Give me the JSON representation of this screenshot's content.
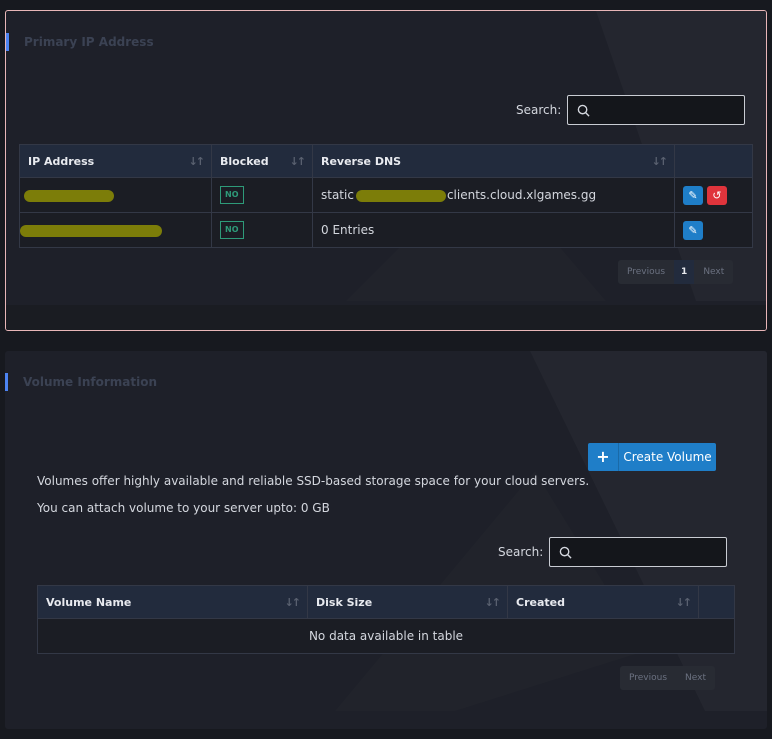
{
  "primary_ip": {
    "title": "Primary IP Address",
    "search_label": "Search:",
    "search_value": "",
    "columns": [
      "IP Address",
      "Blocked",
      "Reverse DNS",
      ""
    ],
    "rows": [
      {
        "ip": "",
        "blocked": "NO",
        "dns_prefix": "static",
        "dns_suffix": "clients.cloud.xlgames.gg"
      },
      {
        "ip": "",
        "blocked": "NO",
        "dns_text": "0 Entries"
      }
    ],
    "pagination": {
      "previous": "Previous",
      "current": "1",
      "next": "Next"
    }
  },
  "volume": {
    "title": "Volume Information",
    "create_button": "Create Volume",
    "description": "Volumes offer highly available and reliable SSD-based storage space for your cloud servers.",
    "limit_text": "You can attach volume to your server upto: 0 GB",
    "search_label": "Search:",
    "search_value": "",
    "columns": [
      "Volume Name",
      "Disk Size",
      "Created",
      ""
    ],
    "empty_text": "No data available in table",
    "pagination": {
      "previous": "Previous",
      "next": "Next"
    }
  },
  "colors": {
    "accent": "#4d84f2",
    "button_blue": "#1f7ec8",
    "button_red": "#e0343c",
    "badge_green": "#2e9a79",
    "redaction": "#7c7d09"
  }
}
